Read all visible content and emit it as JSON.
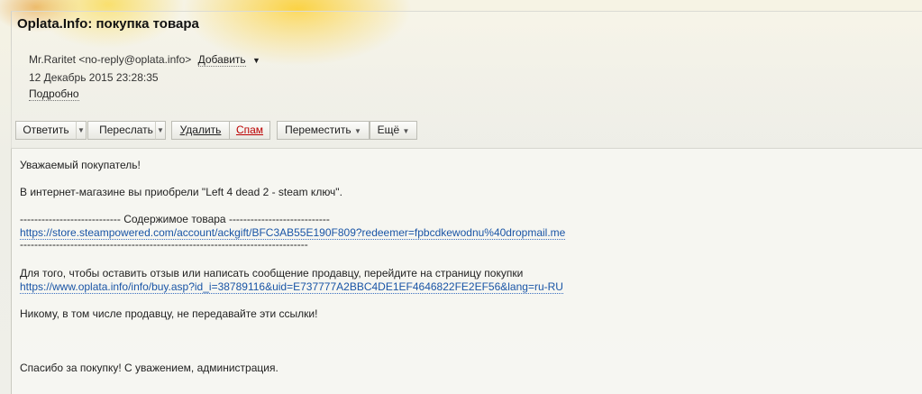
{
  "message": {
    "subject": "Oplata.Info: покупка товара",
    "sender": "Mr.Raritet <no-reply@oplata.info>",
    "add_label": "Добавить",
    "date": "12 Декабрь 2015 23:28:35",
    "details_label": "Подробно"
  },
  "toolbar": {
    "reply": "Ответить",
    "forward": "Переслать",
    "delete": "Удалить",
    "spam": "Спам",
    "move": "Переместить",
    "more": "Ещё",
    "dropdown_glyph": "▼"
  },
  "body": {
    "greeting": "Уважаемый покупатель!",
    "purchased": "В интернет-магазине вы приобрели \"Left 4 dead 2 - steam ключ\".",
    "contents_header": "---------------------------- Содержимое товара ----------------------------",
    "steam_link": "https://store.steampowered.com/account/ackgift/BFC3AB55E190F809?redeemer=fpbcdkewodnu%40dropmail.me",
    "contents_footer": "--------------------------------------------------------------------------------",
    "feedback_text": "Для того, чтобы оставить отзыв или написать сообщение продавцу, перейдите на страницу покупки",
    "buy_link": "https://www.oplata.info/info/buy.asp?id_i=38789116&uid=E737777A2BBC4DE1EF4646822FE2EF56&lang=ru-RU",
    "warning": "Никому, в том числе продавцу, не передавайте эти ссылки!",
    "thanks": "Спасибо за покупку! С уважением, администрация."
  }
}
